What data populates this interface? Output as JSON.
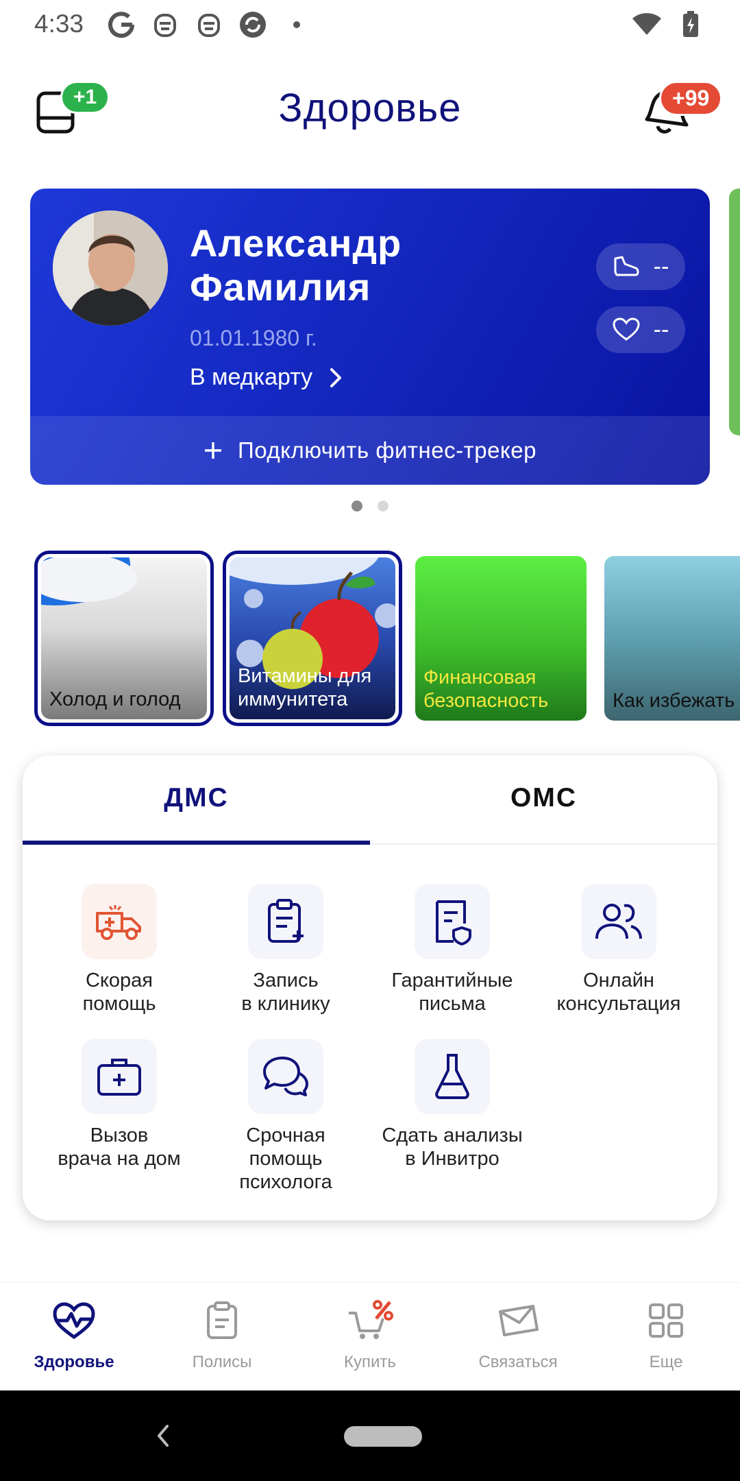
{
  "status_bar": {
    "time": "4:33"
  },
  "header": {
    "title": "Здоровье",
    "wallet_badge": "+1",
    "notifications_badge": "+99"
  },
  "profile": {
    "first_name": "Александр",
    "last_name": "Фамилия",
    "dob": "01.01.1980 г.",
    "medcard_link": "В медкарту",
    "steps_value": "--",
    "heart_value": "--",
    "connect_tracker": "Подключить фитнес-трекер"
  },
  "carousel": {
    "pages": 2,
    "active": 0
  },
  "stories": [
    {
      "label": "Холод и голод"
    },
    {
      "label": "Витамины для иммунитета"
    },
    {
      "label": "Финансовая безопасность"
    },
    {
      "label": "Как избежать обморожения"
    }
  ],
  "services": {
    "tabs": [
      "ДМС",
      "ОМС"
    ],
    "active_tab": "ДМС",
    "items": [
      {
        "label": "Скорая\nпомощь",
        "icon": "ambulance-icon"
      },
      {
        "label": "Запись\nв клинику",
        "icon": "clipboard-add-icon"
      },
      {
        "label": "Гарантийные\nписьма",
        "icon": "document-shield-icon"
      },
      {
        "label": "Онлайн\nконсультация",
        "icon": "people-icon"
      },
      {
        "label": "Вызов\nврача на дом",
        "icon": "medkit-icon"
      },
      {
        "label": "Срочная\nпомощь\nпсихолога",
        "icon": "chat-bubbles-icon"
      },
      {
        "label": "Сдать анализы\nв Инвитро",
        "icon": "flask-icon"
      }
    ]
  },
  "bottom_nav": {
    "items": [
      {
        "label": "Здоровье",
        "icon": "heart-pulse-icon"
      },
      {
        "label": "Полисы",
        "icon": "clipboard-icon"
      },
      {
        "label": "Купить",
        "icon": "cart-percent-icon"
      },
      {
        "label": "Связаться",
        "icon": "envelope-icon"
      },
      {
        "label": "Еще",
        "icon": "grid-icon"
      }
    ],
    "active": "Здоровье"
  },
  "colors": {
    "brand_navy": "#10127a",
    "card_blue": "#1428c0",
    "badge_green": "#2bb24c",
    "badge_red": "#e44a34",
    "ambulance_red": "#e05533"
  }
}
